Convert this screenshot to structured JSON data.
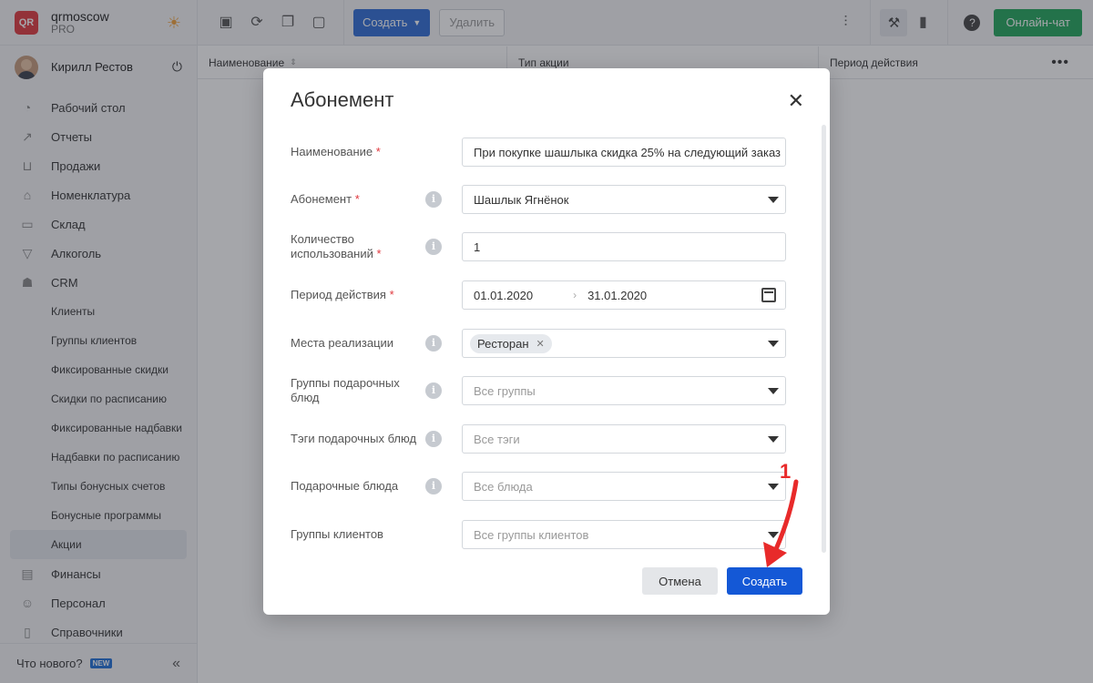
{
  "brand": {
    "logo": "QR",
    "name": "qrmoscow",
    "plan": "PRO"
  },
  "user": {
    "name": "Кирилл Рестов"
  },
  "nav": {
    "items_top": [
      {
        "label": "Рабочий стол",
        "icon": "speedometer-icon"
      },
      {
        "label": "Отчеты",
        "icon": "chart-icon"
      },
      {
        "label": "Продажи",
        "icon": "basket-icon"
      },
      {
        "label": "Номенклатура",
        "icon": "tag-icon"
      },
      {
        "label": "Склад",
        "icon": "box-icon"
      },
      {
        "label": "Алкоголь",
        "icon": "cocktail-icon"
      },
      {
        "label": "CRM",
        "icon": "users-icon"
      }
    ],
    "crm_sub": [
      "Клиенты",
      "Группы клиентов",
      "Фиксированные скидки",
      "Скидки по расписанию",
      "Фиксированные надбавки",
      "Надбавки по расписанию",
      "Типы бонусных счетов",
      "Бонусные программы",
      "Акции"
    ],
    "items_bottom": [
      {
        "label": "Финансы",
        "icon": "wallet-icon"
      },
      {
        "label": "Персонал",
        "icon": "person-icon"
      },
      {
        "label": "Справочники",
        "icon": "book-icon"
      }
    ],
    "whats_new": "Что нового?",
    "new_badge": "NEW"
  },
  "toolbar": {
    "create_label": "Создать",
    "delete_label": "Удалить",
    "chat_label": "Онлайн-чат"
  },
  "table": {
    "columns": [
      "Наименование",
      "Тип акции",
      "Период действия"
    ]
  },
  "modal": {
    "title": "Абонемент",
    "fields": {
      "name": {
        "label": "Наименование",
        "value": "При покупке шашлыка скидка 25% на следующий заказ"
      },
      "subscription": {
        "label": "Абонемент",
        "value": "Шашлык Ягнёнок"
      },
      "uses": {
        "label": "Количество использований",
        "value": "1"
      },
      "period": {
        "label": "Период действия",
        "from": "01.01.2020",
        "to": "31.01.2020"
      },
      "places": {
        "label": "Места реализации",
        "tag": "Ресторан"
      },
      "gift_groups": {
        "label": "Группы подарочных блюд",
        "placeholder": "Все группы"
      },
      "gift_tags": {
        "label": "Тэги подарочных блюд",
        "placeholder": "Все тэги"
      },
      "gift_dishes": {
        "label": "Подарочные блюда",
        "placeholder": "Все блюда"
      },
      "client_groups": {
        "label": "Группы клиентов",
        "placeholder": "Все группы клиентов"
      }
    },
    "required_mark": "*",
    "cancel_label": "Отмена",
    "create_label": "Создать"
  },
  "annotation": {
    "number": "1",
    "color": "#e82a2a"
  },
  "colors": {
    "primary": "#1458d6",
    "chat": "#1fa55a",
    "required": "#e0373d"
  }
}
